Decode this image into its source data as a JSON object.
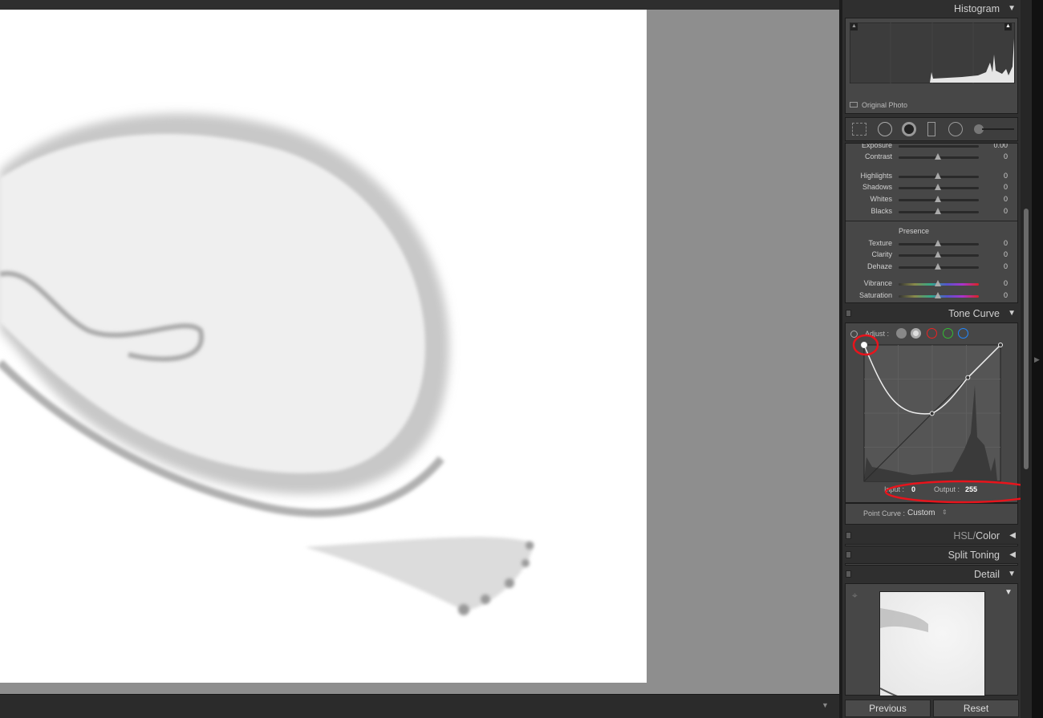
{
  "panels": {
    "histogram": {
      "title": "Histogram",
      "original_photo": "Original Photo"
    },
    "basic": {
      "partial_label": "Exposure",
      "partial_value": "0.00",
      "sliders_tone": [
        {
          "label": "Contrast",
          "value": "0"
        }
      ],
      "sliders_tone2": [
        {
          "label": "Highlights",
          "value": "0"
        },
        {
          "label": "Shadows",
          "value": "0"
        },
        {
          "label": "Whites",
          "value": "0"
        },
        {
          "label": "Blacks",
          "value": "0"
        }
      ],
      "presence_title": "Presence",
      "sliders_presence": [
        {
          "label": "Texture",
          "value": "0"
        },
        {
          "label": "Clarity",
          "value": "0"
        },
        {
          "label": "Dehaze",
          "value": "0"
        }
      ],
      "sliders_color": [
        {
          "label": "Vibrance",
          "value": "0"
        },
        {
          "label": "Saturation",
          "value": "0"
        }
      ]
    },
    "tone_curve": {
      "title": "Tone Curve",
      "adjust_label": "Adjust :",
      "input_label": "Input :",
      "input_value": "0",
      "output_label": "Output :",
      "output_value": "255",
      "point_curve_label": "Point Curve :",
      "point_curve_value": "Custom",
      "curve_points": [
        [
          0,
          255
        ],
        [
          127,
          127
        ],
        [
          194,
          194
        ],
        [
          255,
          255
        ]
      ],
      "annotation_color": "#e8141c"
    },
    "hsl": {
      "title_a": "HSL",
      "sep": "/",
      "title_b": "Color"
    },
    "split_toning": {
      "title": "Split Toning"
    },
    "detail": {
      "title": "Detail"
    }
  },
  "buttons": {
    "previous": "Previous",
    "reset": "Reset"
  }
}
